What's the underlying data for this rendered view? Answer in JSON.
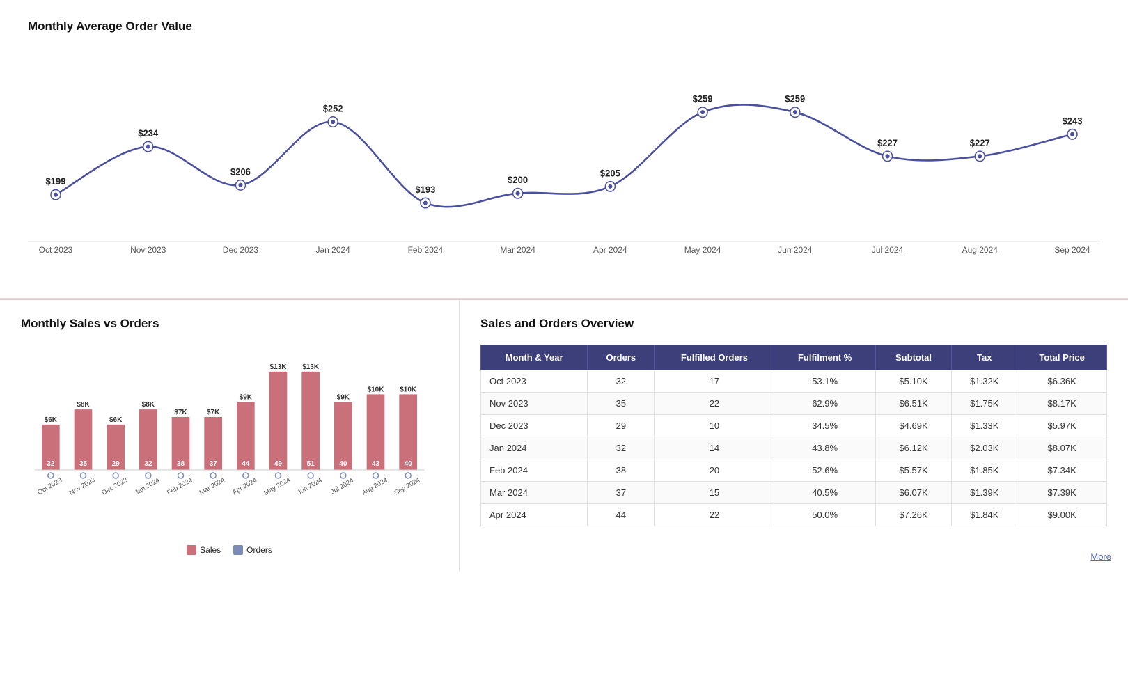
{
  "topChart": {
    "title": "Monthly Average Order Value",
    "dataPoints": [
      {
        "label": "Oct 2023",
        "value": 199,
        "display": "$199"
      },
      {
        "label": "Nov 2023",
        "value": 234,
        "display": "$234"
      },
      {
        "label": "Dec 2023",
        "value": 206,
        "display": "$206"
      },
      {
        "label": "Jan 2024",
        "value": 252,
        "display": "$252"
      },
      {
        "label": "Feb 2024",
        "value": 193,
        "display": "$193"
      },
      {
        "label": "Mar 2024",
        "value": 200,
        "display": "$200"
      },
      {
        "label": "Apr 2024",
        "value": 205,
        "display": "$205"
      },
      {
        "label": "May 2024",
        "value": 259,
        "display": "$259"
      },
      {
        "label": "Jun 2024",
        "value": 259,
        "display": "$259"
      },
      {
        "label": "Jul 2024",
        "value": 227,
        "display": "$227"
      },
      {
        "label": "Aug 2024",
        "value": 227,
        "display": "$227"
      },
      {
        "label": "Sep 2024",
        "value": 243,
        "display": "$243"
      }
    ],
    "lineColor": "#4a4fa0",
    "dotColor": "#4a4fa0"
  },
  "barChart": {
    "title": "Monthly Sales vs Orders",
    "months": [
      "Oct 2023",
      "Nov 2023",
      "Dec 2023",
      "Jan 2024",
      "Feb 2024",
      "Mar 2024",
      "Apr 2024",
      "May 2024",
      "Jun 2024",
      "Jul 2024",
      "Aug 2024",
      "Sep 2024"
    ],
    "sales": [
      6,
      8,
      6,
      8,
      7,
      7,
      9,
      13,
      13,
      9,
      10,
      10
    ],
    "salesLabels": [
      "$6K",
      "$8K",
      "$6K",
      "$8K",
      "$7K",
      "$7K",
      "$9K",
      "$13K",
      "$13K",
      "$9K",
      "$10K",
      "$10K"
    ],
    "orders": [
      32,
      35,
      29,
      32,
      38,
      37,
      44,
      49,
      51,
      40,
      43,
      40
    ],
    "salesColor": "#c9707a",
    "ordersColor": "#7c8cb8",
    "legend": {
      "salesLabel": "Sales",
      "ordersLabel": "Orders"
    }
  },
  "overviewTable": {
    "title": "Sales and Orders Overview",
    "headers": [
      "Month & Year",
      "Orders",
      "Fulfilled Orders",
      "Fulfilment %",
      "Subtotal",
      "Tax",
      "Total Price"
    ],
    "rows": [
      {
        "month": "Oct 2023",
        "orders": 32,
        "fulfilled": 17,
        "pct": "53.1%",
        "subtotal": "$5.10K",
        "tax": "$1.32K",
        "total": "$6.36K"
      },
      {
        "month": "Nov 2023",
        "orders": 35,
        "fulfilled": 22,
        "pct": "62.9%",
        "subtotal": "$6.51K",
        "tax": "$1.75K",
        "total": "$8.17K"
      },
      {
        "month": "Dec 2023",
        "orders": 29,
        "fulfilled": 10,
        "pct": "34.5%",
        "subtotal": "$4.69K",
        "tax": "$1.33K",
        "total": "$5.97K"
      },
      {
        "month": "Jan 2024",
        "orders": 32,
        "fulfilled": 14,
        "pct": "43.8%",
        "subtotal": "$6.12K",
        "tax": "$2.03K",
        "total": "$8.07K"
      },
      {
        "month": "Feb 2024",
        "orders": 38,
        "fulfilled": 20,
        "pct": "52.6%",
        "subtotal": "$5.57K",
        "tax": "$1.85K",
        "total": "$7.34K"
      },
      {
        "month": "Mar 2024",
        "orders": 37,
        "fulfilled": 15,
        "pct": "40.5%",
        "subtotal": "$6.07K",
        "tax": "$1.39K",
        "total": "$7.39K"
      },
      {
        "month": "Apr 2024",
        "orders": 44,
        "fulfilled": 22,
        "pct": "50.0%",
        "subtotal": "$7.26K",
        "tax": "$1.84K",
        "total": "$9.00K"
      }
    ]
  },
  "more": {
    "label": "More"
  }
}
